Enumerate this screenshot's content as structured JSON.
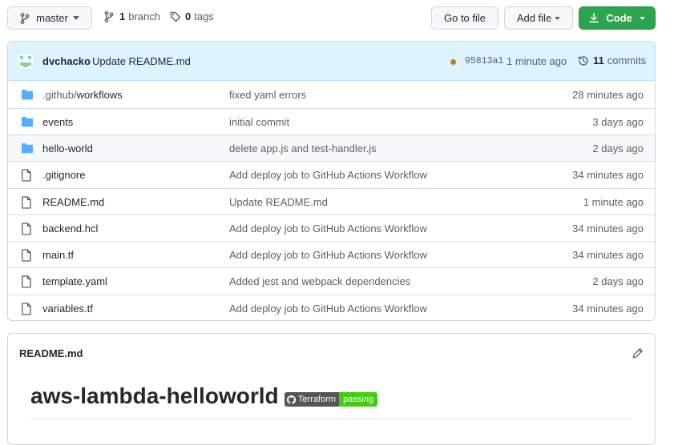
{
  "toolbar": {
    "branch_label": "master",
    "branches_count": "1",
    "branches_label": "branch",
    "tags_count": "0",
    "tags_label": "tags",
    "go_to_file": "Go to file",
    "add_file": "Add file",
    "code": "Code"
  },
  "commit": {
    "author": "dvchacko",
    "message": "Update README.md",
    "sha": "95813a1",
    "time": "1 minute ago",
    "commits_count": "11",
    "commits_label": "commits"
  },
  "files": [
    {
      "type": "dir",
      "name_prefix": ".github/",
      "name_suffix": "workflows",
      "message": "fixed yaml errors",
      "time": "28 minutes ago"
    },
    {
      "type": "dir",
      "name_prefix": "events",
      "name_suffix": "",
      "message": "initial commit",
      "time": "3 days ago"
    },
    {
      "type": "dir",
      "name_prefix": "hello-world",
      "name_suffix": "",
      "message": "delete app.js and test-handler.js",
      "time": "2 days ago"
    },
    {
      "type": "file",
      "name_prefix": ".gitignore",
      "name_suffix": "",
      "message": "Add deploy job to GitHub Actions Workflow",
      "time": "34 minutes ago"
    },
    {
      "type": "file",
      "name_prefix": "README.md",
      "name_suffix": "",
      "message": "Update README.md",
      "time": "1 minute ago"
    },
    {
      "type": "file",
      "name_prefix": "backend.hcl",
      "name_suffix": "",
      "message": "Add deploy job to GitHub Actions Workflow",
      "time": "34 minutes ago"
    },
    {
      "type": "file",
      "name_prefix": "main.tf",
      "name_suffix": "",
      "message": "Add deploy job to GitHub Actions Workflow",
      "time": "34 minutes ago"
    },
    {
      "type": "file",
      "name_prefix": "template.yaml",
      "name_suffix": "",
      "message": "Added jest and webpack dependencies",
      "time": "2 days ago"
    },
    {
      "type": "file",
      "name_prefix": "variables.tf",
      "name_suffix": "",
      "message": "Add deploy job to GitHub Actions Workflow",
      "time": "34 minutes ago"
    }
  ],
  "readme": {
    "filename": "README.md",
    "title": "aws-lambda-helloworld",
    "badge_label": "Terraform",
    "badge_status": "passing"
  },
  "colors": {
    "primary_green": "#2da44e",
    "folder_blue": "#54aeff",
    "commit_bar_bg": "#ddf4ff",
    "status_pending": "#bf8700"
  },
  "icons": {
    "branch": "git-branch-icon",
    "tag": "tag-icon",
    "folder": "folder-icon",
    "file": "file-icon",
    "history": "history-icon",
    "download": "download-icon",
    "pencil": "pencil-icon"
  }
}
